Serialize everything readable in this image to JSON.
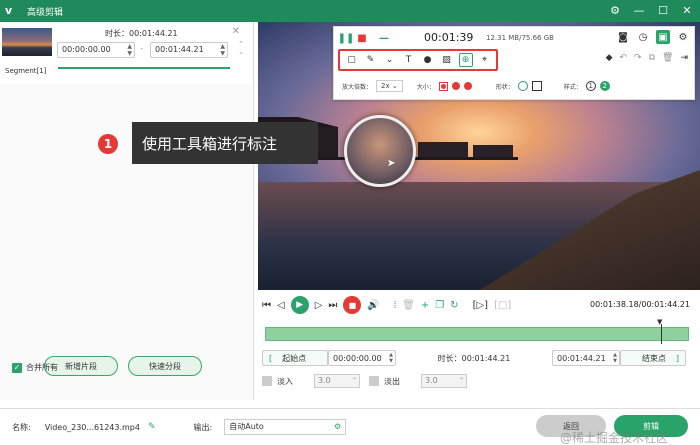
{
  "app": {
    "title": "高级剪辑",
    "logo": "v"
  },
  "segment": {
    "duration_label": "时长：00:01:44.21",
    "start": "00:00:00.00",
    "end": "00:01:44.21",
    "name": "Segment[1]"
  },
  "left_actions": {
    "add_segment": "新增片段",
    "quick_split": "快速分段",
    "merge_all": "合并所有"
  },
  "toolbox": {
    "rec_time": "00:01:39",
    "rec_size": "12.31 MB/75.66 GB",
    "zoom_label": "放大倍数：",
    "zoom_value": "2x",
    "size_label": "大小：",
    "shape_label": "形状：",
    "style_label": "样式：",
    "style_1": "1",
    "style_2": "2"
  },
  "annotation": {
    "number": "1",
    "text": "使用工具箱进行标注"
  },
  "player": {
    "time": "00:01:38.18/00:01:44.21"
  },
  "range": {
    "start_btn": "起始点",
    "start_val": "00:00:00.00",
    "duration": "时长：00:01:44.21",
    "end_val": "00:01:44.21",
    "end_btn": "结束点"
  },
  "fade": {
    "fade_in": "淡入",
    "fade_in_val": "3.0",
    "fade_out": "淡出",
    "fade_out_val": "3.0"
  },
  "bottom": {
    "name_label": "名称:",
    "name_value": "Video_230...61243.mp4",
    "output_label": "输出:",
    "output_value": "自动Auto",
    "back": "返回",
    "cut": "剪辑",
    "watermark": "@稀土掘金技术社区"
  },
  "colors": {
    "brand": "#1f8b5a",
    "accent": "#2aa36b",
    "danger": "#e53935"
  }
}
